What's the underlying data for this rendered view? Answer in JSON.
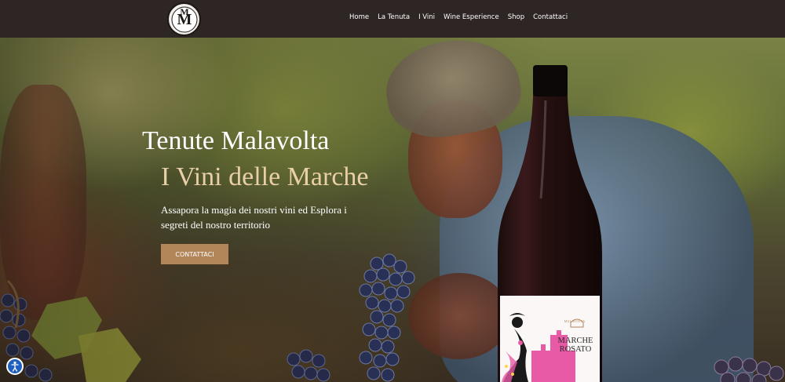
{
  "brand": {
    "logo_letters": "M"
  },
  "nav": {
    "items": [
      "Home",
      "La Tenuta",
      "I Vini",
      "Wine Esperience",
      "Shop",
      "Contattaci"
    ]
  },
  "hero": {
    "title": "Tenute Malavolta",
    "subtitle": "I Vini delle Marche",
    "text": "Assapora la magia dei nostri vini ed Esplora i segreti del nostro territorio",
    "cta_label": "CONTATTACI"
  },
  "bottle_label": {
    "brand": "MALAVOLTA",
    "name_line1": "MARCHE",
    "name_line2": "ROSATO"
  },
  "colors": {
    "header_bg": "#2d2624",
    "cta_bg": "#b3865a",
    "subtitle": "#e9cfa8",
    "label_pink": "#e95aa6"
  },
  "icons": [
    "logo-icon",
    "accessibility-icon"
  ]
}
